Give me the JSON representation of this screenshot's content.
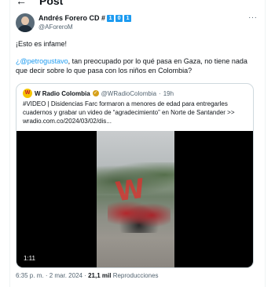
{
  "header": {
    "title": "Post",
    "back_icon": "arrow-left-icon"
  },
  "author": {
    "name": "Andrés Forero CD #",
    "badges": [
      "1",
      "0",
      "1"
    ],
    "handle": "@AForeroM",
    "more_icon": "more-horizontal-icon"
  },
  "tweet": {
    "line1": "¡Esto es infame!",
    "mention": "¿@petrogustavo",
    "line2_rest": ", tan preocupado por lo qué pasa en Gaza, no tiene nada que decir sobre lo que pasa con los niños en Colombia?"
  },
  "quote": {
    "avatar_text": "W",
    "name": "W Radio Colombia",
    "handle": "@WRadioColombia",
    "sep": "·",
    "time": "19h",
    "text": "#VIDEO | Disidencias Farc formaron a menores de edad para entregarles cuadernos y grabar un video de “agradecimiento” en Norte de Santander >> wradio.com.co/2024/03/02/dis...",
    "video_duration": "1:11"
  },
  "meta": {
    "time": "6:35 p. m.",
    "sep1": "·",
    "date": "2 mar. 2024",
    "sep2": "·",
    "views_count": "21,1 mil",
    "views_label": "Reproducciones"
  },
  "colors": {
    "accent": "#1d9bf0",
    "text": "#0f1419",
    "secondary": "#536471",
    "border": "#cfd9de"
  }
}
